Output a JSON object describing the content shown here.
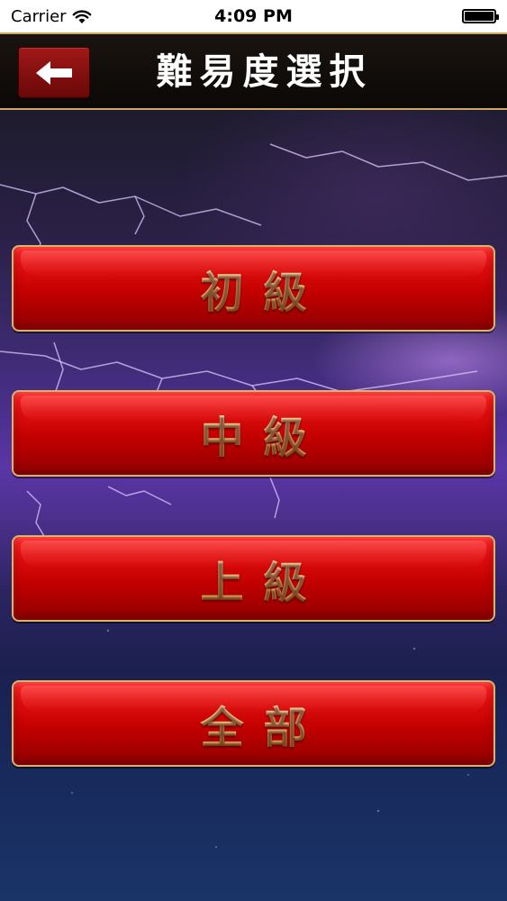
{
  "status_bar": {
    "carrier": "Carrier",
    "time": "4:09 PM",
    "wifi_icon": "wifi-icon",
    "battery_icon": "battery-icon",
    "battery_level": 1.0
  },
  "header": {
    "title": "難易度選択",
    "back_icon": "arrow-left-icon"
  },
  "levels": [
    {
      "label": "初級"
    },
    {
      "label": "中級"
    },
    {
      "label": "上級"
    },
    {
      "label": "全部"
    }
  ],
  "colors": {
    "button_red": "#c30000",
    "button_border": "#d9b46a",
    "label_gold": "#f1d487",
    "header_border": "#caa85c"
  }
}
